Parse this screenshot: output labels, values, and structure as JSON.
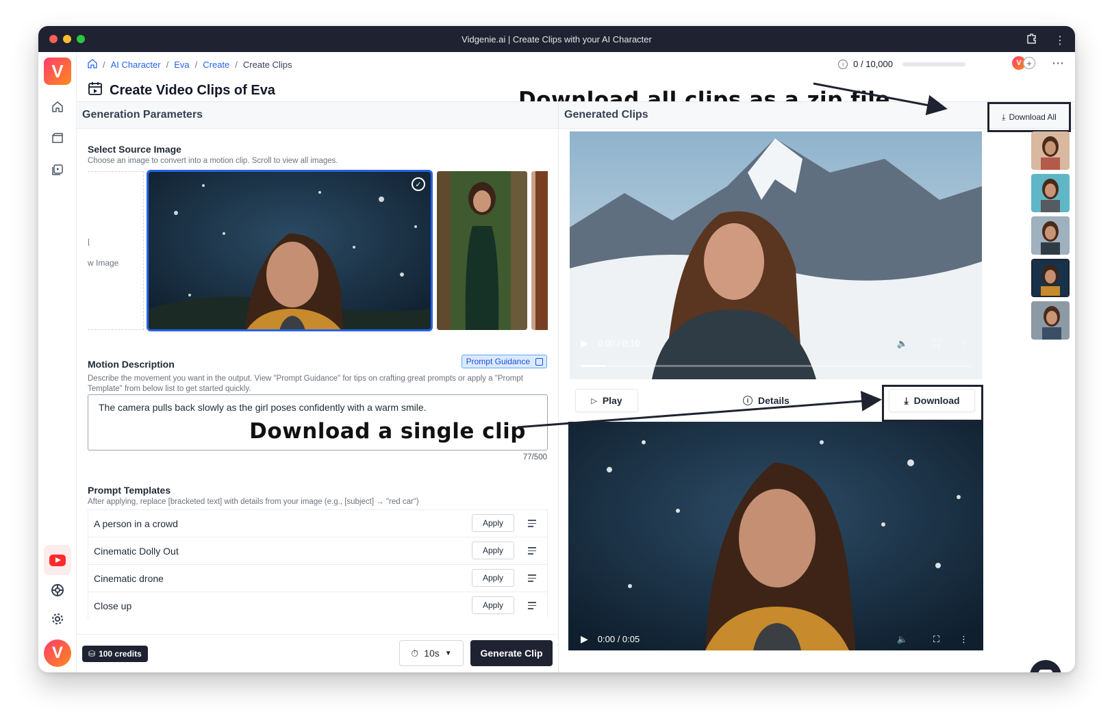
{
  "window": {
    "title": "Vidgenie.ai | Create Clips with your AI Character"
  },
  "breadcrumb": {
    "items": [
      "AI Character",
      "Eva",
      "Create"
    ],
    "current": "Create Clips"
  },
  "page": {
    "title": "Create Video Clips of Eva"
  },
  "usage": {
    "text": "0 / 10,000",
    "fraction": 0
  },
  "annotations": {
    "download_all": "Download all clips as a zip file",
    "download_single": "Download a single clip"
  },
  "left": {
    "header": "Generation Parameters",
    "source": {
      "title": "Select Source Image",
      "desc": "Choose an image to convert into a motion clip. Scroll to view all images.",
      "upload_label": "w Image"
    },
    "motion": {
      "title": "Motion Description",
      "guidance_label": "Prompt Guidance",
      "desc": "Describe the movement you want in the output. View \"Prompt Guidance\" for tips on crafting great prompts or apply a \"Prompt Template\" from below list to get started quickly.",
      "value": "The camera pulls back slowly as the girl poses confidently with a warm smile.",
      "count": "77/500"
    },
    "templates": {
      "title": "Prompt Templates",
      "desc": "After applying, replace [bracketed text] with details from your image (e.g., [subject] → \"red car\")",
      "apply_label": "Apply",
      "items": [
        "A person in a crowd",
        "Cinematic Dolly Out",
        "Cinematic drone",
        "Close up"
      ]
    },
    "footer": {
      "credits": "100 credits",
      "duration": "10s",
      "generate": "Generate Clip"
    }
  },
  "right": {
    "header": "Generated Clips",
    "download_all": "Download All",
    "clip1": {
      "time": "0:00 / 0:10",
      "progress": 0.06
    },
    "actions": {
      "play": "Play",
      "details": "Details",
      "download": "Download"
    },
    "clip2": {
      "time": "0:00 / 0:05"
    }
  },
  "colors": {
    "accent": "#2563eb",
    "dark": "#1f2230",
    "brand_gradient_start": "#ff3b6b",
    "brand_gradient_end": "#ff8a1e"
  }
}
